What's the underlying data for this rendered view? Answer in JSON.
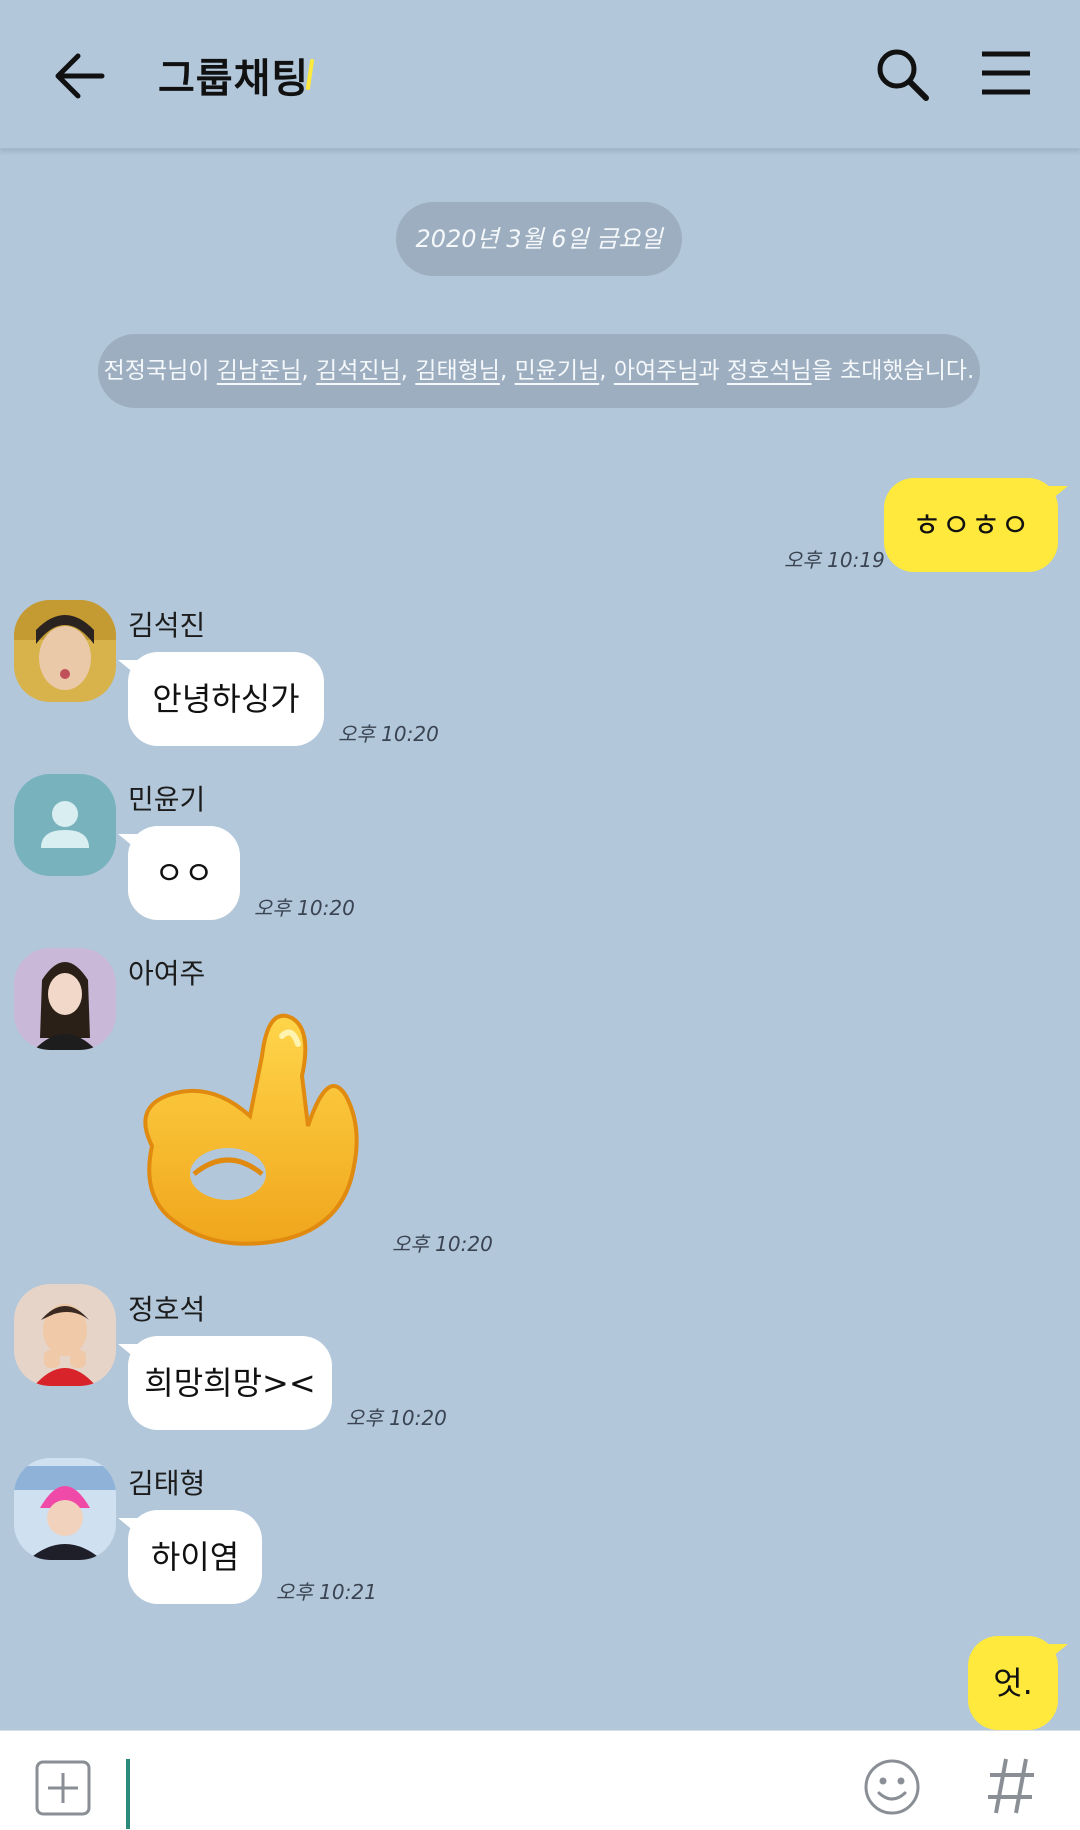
{
  "header": {
    "title": "그룹채팅",
    "accent_color": "#fee93c",
    "back_icon": "arrow-left-icon",
    "search_icon": "search-icon",
    "menu_icon": "hamburger-menu-icon"
  },
  "date_divider": "2020년 3월 6일 금요일",
  "invite_notice": {
    "inviter": "전정국님이",
    "invitees": [
      "김남준님",
      "김석진님",
      "김태형님",
      "민윤기님",
      "아여주님",
      "정호석님"
    ],
    "suffix": "을 초대했습니다."
  },
  "messages": [
    {
      "from": "me",
      "text": "ㅎㅇㅎㅇ",
      "time": "오후 10:19"
    },
    {
      "from": "김석진",
      "text": "안녕하싱가",
      "time": "오후 10:20"
    },
    {
      "from": "민윤기",
      "text": "ㅇㅇ",
      "time": "오후 10:20",
      "avatar": "default-profile-icon"
    },
    {
      "from": "아여주",
      "sticker": "ok-hand-sticker",
      "time": "오후 10:20"
    },
    {
      "from": "정호석",
      "text": "희망희망><",
      "time": "오후 10:20"
    },
    {
      "from": "김태형",
      "text": "하이염",
      "time": "오후 10:21"
    },
    {
      "from": "me",
      "text": "엇."
    }
  ],
  "input_bar": {
    "value": "",
    "plus_icon": "plus-square-icon",
    "emoji_icon": "emoticon-icon",
    "hash_icon": "hashtag-icon"
  },
  "colors": {
    "background": "#b2c7da",
    "my_bubble": "#fee93c",
    "other_bubble": "#ffffff",
    "notice_pill": "#9caebf",
    "cursor": "#2b8a7c"
  }
}
